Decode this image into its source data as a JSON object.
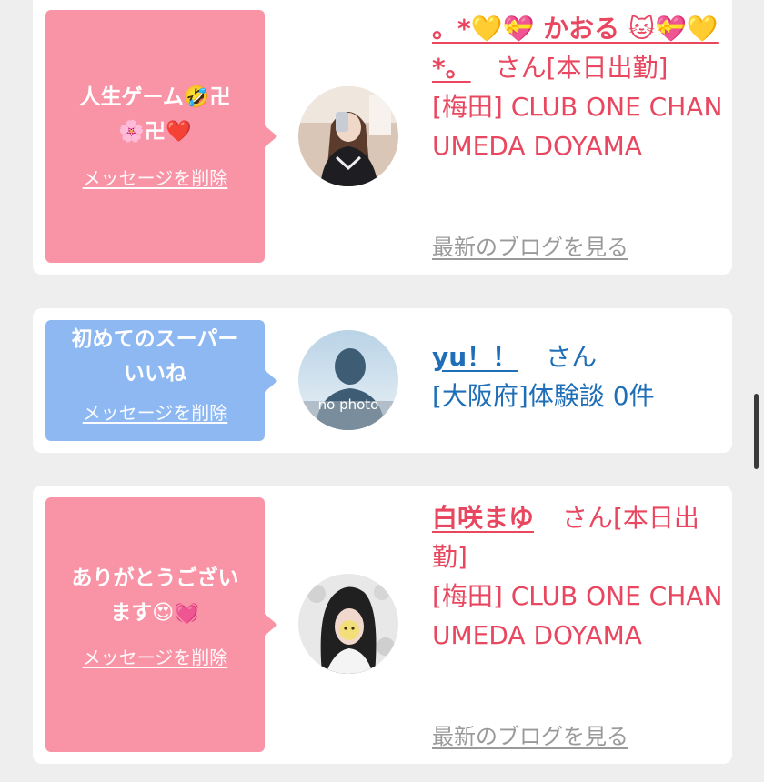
{
  "colors": {
    "background": "#eeeeee",
    "card": "#ffffff",
    "bubble_pink": "#f994a7",
    "bubble_blue": "#8eb8f2",
    "name_pink": "#e8475f",
    "name_blue": "#1f6fb8",
    "link_gray": "#9a9a9a"
  },
  "messages": [
    {
      "text": "人生ゲーム🤣卍\n🌸卍❤️",
      "bubble_color": "pink",
      "delete_label": "メッセージを削除",
      "avatar": "user-photo-1",
      "name": "。*💛💝 かおる 🐱💝💛*。",
      "honorific": "さん",
      "status": "[本日出勤]",
      "location": "[梅田] CLUB ONE CHAN UMEDA DOYAMA",
      "blog_label": "最新のブログを見る"
    },
    {
      "text": "初めてのスーパー\nいいね",
      "bubble_color": "blue",
      "delete_label": "メッセージを削除",
      "avatar": "no-photo",
      "avatar_text": "no photo",
      "name": "yu！！",
      "honorific": "さん",
      "location": "[大阪府]体験談 0件"
    },
    {
      "text": "ありがとうござい\nます😍💓",
      "bubble_color": "pink",
      "delete_label": "メッセージを削除",
      "avatar": "user-photo-3",
      "name": "白咲まゆ",
      "honorific": "さん",
      "status": "[本日出勤]",
      "location": "[梅田] CLUB ONE CHAN UMEDA DOYAMA",
      "blog_label": "最新のブログを見る"
    }
  ]
}
